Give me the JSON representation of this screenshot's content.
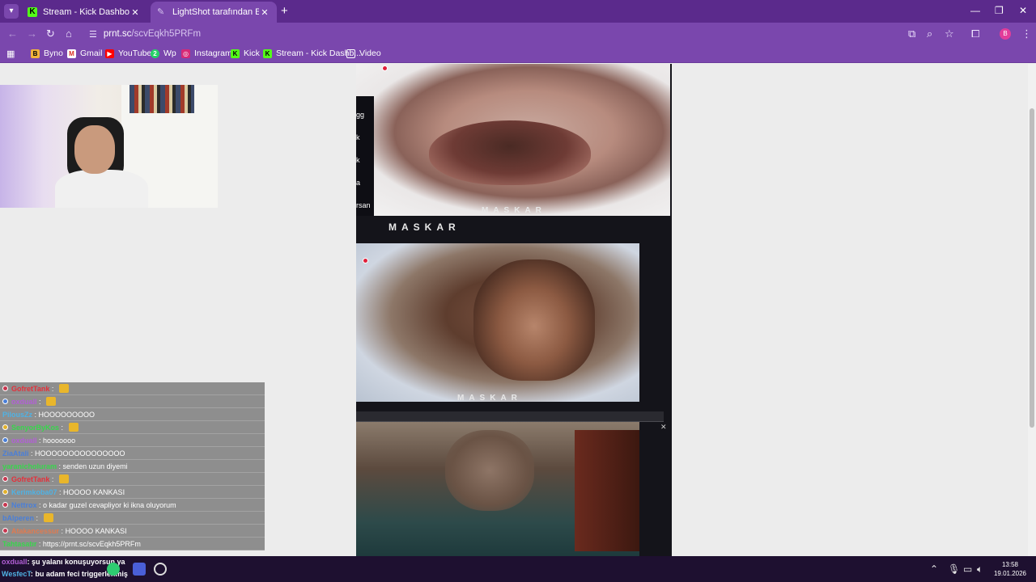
{
  "browser": {
    "tabs": [
      {
        "title": "Stream - Kick Dashboard",
        "icon": "kick-icon"
      },
      {
        "title": "LightShot tarafından Ekran Görüntüsü",
        "icon": "feather-icon",
        "active": true
      }
    ],
    "url_host": "prnt.sc",
    "url_path": "/scvEqkh5PRFm",
    "profile_initial": "B",
    "bookmarks": [
      {
        "label": "Byno",
        "icon": "byno-icon"
      },
      {
        "label": "Gmail",
        "icon": "gmail-icon"
      },
      {
        "label": "YouTube",
        "icon": "youtube-icon"
      },
      {
        "label": "Wp",
        "icon": "whatsapp-icon"
      },
      {
        "label": "Instagram",
        "icon": "instagram-icon"
      },
      {
        "label": "Kick",
        "icon": "kick-icon"
      },
      {
        "label": "Stream - Kick Dashb...",
        "icon": "kick-icon"
      },
      {
        "label": "Video",
        "icon": "folder-icon"
      }
    ]
  },
  "screenshot": {
    "watermark_top": "MASKAR",
    "watermark_mid": "MASKAR",
    "watermark_bottom": "MASKAR",
    "side_text": [
      "gg",
      "k",
      "k",
      "a",
      "rsan"
    ]
  },
  "chat": [
    {
      "user": "GofretTank",
      "color": "#e5303b",
      "text": "",
      "emote": true,
      "badge": "#c7364f"
    },
    {
      "user": "oxduall",
      "color": "#b25fd6",
      "text": "",
      "emote": true,
      "badge": "#4a7fd8"
    },
    {
      "user": "PilousZz",
      "color": "#4fb2e4",
      "text": "HOOOOOOOOO",
      "emote": false,
      "badge": ""
    },
    {
      "user": "SenyorByKos",
      "color": "#37d64c",
      "text": "",
      "emote": true,
      "badge": "#e2b12a"
    },
    {
      "user": "oxduall",
      "color": "#b25fd6",
      "text": "hooooooo",
      "emote": false,
      "badge": "#4a7fd8"
    },
    {
      "user": "ZiaAtali",
      "color": "#4a7fd8",
      "text": "HOOOOOOOOOOOOOOO",
      "emote": false,
      "badge": ""
    },
    {
      "user": "yaranicholuram",
      "color": "#37d64c",
      "text": "senden uzun diyemi",
      "emote": false,
      "badge": ""
    },
    {
      "user": "GofretTank",
      "color": "#e5303b",
      "text": "",
      "emote": true,
      "badge": "#c7364f"
    },
    {
      "user": "Kerimkoba07",
      "color": "#4fb2e4",
      "text": "HOOOO KANKASI",
      "emote": false,
      "badge": "#e2b12a"
    },
    {
      "user": "Nettrox",
      "color": "#4a7fd8",
      "text": "o kadar guzel cevapliyor ki ikna oluyorum",
      "emote": false,
      "badge": "#c7364f"
    },
    {
      "user": "bAlperen",
      "color": "#4a7fd8",
      "text": "",
      "emote": true,
      "badge": ""
    },
    {
      "user": "Atakancessur",
      "color": "#e07a50",
      "text": "HOOOO KANKASI",
      "emote": false,
      "badge": "#c7364f"
    },
    {
      "user": "Tahtasatır",
      "color": "#37d64c",
      "text": "https://prnt.sc/scvEqkh5PRFm",
      "emote": false,
      "badge": ""
    }
  ],
  "taskbar_chat": [
    {
      "user": "oxduall",
      "color": "#b25fd6",
      "text": "şu yalanı konuşuyorsun ya"
    },
    {
      "user": "WesfecT",
      "color": "#4fb2e4",
      "text": "bu adam feci triggerlenmiş"
    }
  ],
  "clock": {
    "time": "13:58",
    "date": "19.01.2026"
  },
  "colors": {
    "titlebar": "#5b2a8c",
    "toolbar": "#7a47ad",
    "taskbar": "#1e1030"
  }
}
